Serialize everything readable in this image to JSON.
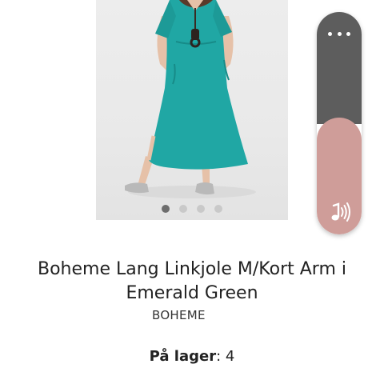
{
  "product": {
    "title": "Boheme Lang Linkjole M/Kort Arm i Emerald Green",
    "brand": "BOHEME",
    "stock_label": "På lager",
    "stock_separator": ":",
    "stock_value": "4"
  },
  "carousel": {
    "slide_count": 4,
    "active_index": 0
  },
  "widget": {
    "more_icon": "more-horizontal-icon",
    "sound_icon": "music-note-sound-icon"
  },
  "colors": {
    "dress": "#20a7a4",
    "widget_top": "#5d5d5d",
    "widget_bottom": "#cf9d99",
    "dot_active": "#6d6d6d",
    "dot_inactive": "#c9c9c9"
  }
}
